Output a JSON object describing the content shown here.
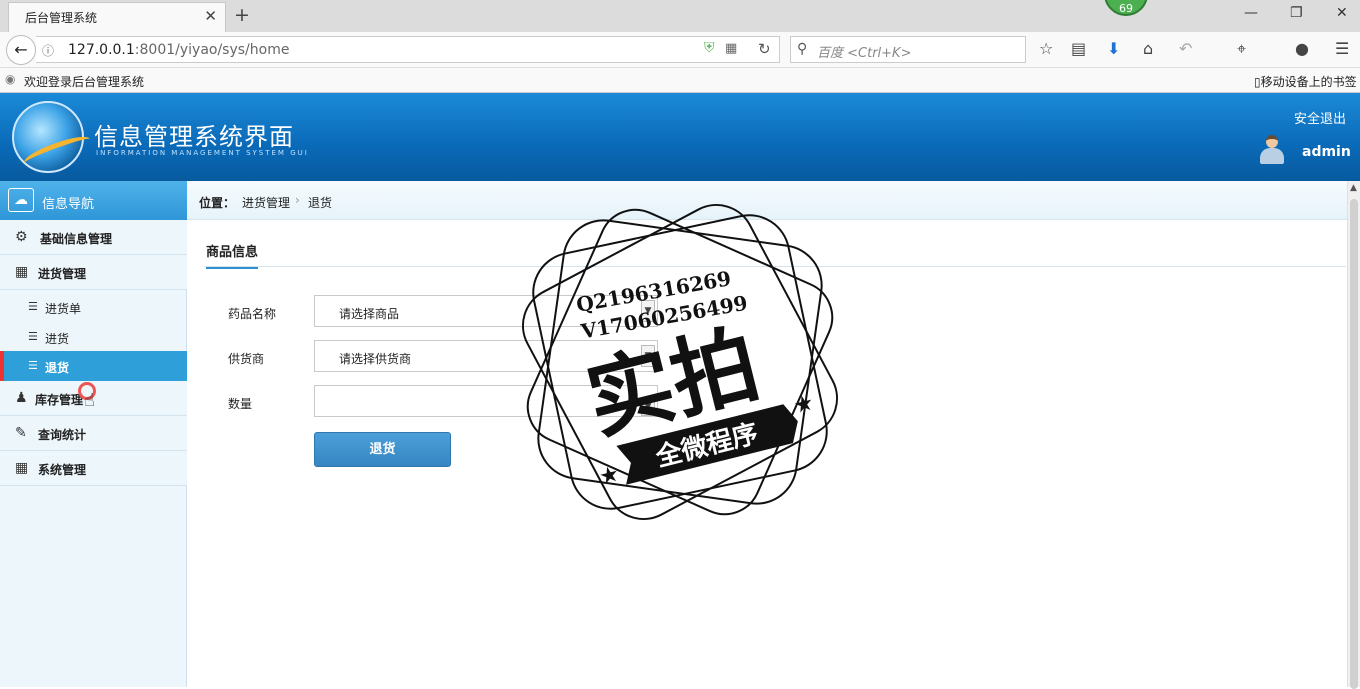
{
  "browser": {
    "tab_title": "后台管理系统",
    "tab_close": "✕",
    "new_tab": "+",
    "ext_badge": "69",
    "url_host": "127.0.0.1",
    "url_rest": ":8001/yiyao/sys/home",
    "search_placeholder": "百度 <Ctrl+K>",
    "bookmark": "欢迎登录后台管理系统",
    "mobile_bookmarks": "移动设备上的书签"
  },
  "header": {
    "title": "信息管理系统界面",
    "subtitle": "INFORMATION MANAGEMENT SYSTEM GUI",
    "logout": "安全退出",
    "user": "admin"
  },
  "sidebar": {
    "title": "信息导航",
    "items": [
      {
        "label": "基础信息管理",
        "icon": "gears-icon"
      },
      {
        "label": "进货管理",
        "icon": "calendar-icon"
      },
      {
        "label": "库存管理",
        "icon": "users-icon"
      },
      {
        "label": "查询统计",
        "icon": "edit-icon"
      },
      {
        "label": "系统管理",
        "icon": "calendar-icon"
      }
    ],
    "subitems": [
      {
        "label": "进货单",
        "icon": "list-icon"
      },
      {
        "label": "进货",
        "icon": "list-icon"
      },
      {
        "label": "退货",
        "icon": "list-icon",
        "active": true
      }
    ]
  },
  "breadcrumb": {
    "label": "位置：",
    "level1": "进货管理",
    "sep": "›",
    "level2": "退货"
  },
  "form": {
    "section": "商品信息",
    "drug_label": "药品名称",
    "drug_value": "请选择商品",
    "supplier_label": "供货商",
    "supplier_value": "请选择供货商",
    "qty_label": "数量",
    "qty_value": "",
    "submit": "退货"
  },
  "watermark": {
    "line1": "Q2196316269",
    "line2": "V17060256499",
    "big": "实拍",
    "banner": "全微程序"
  },
  "colors": {
    "header": "#0a6ab8",
    "active": "#2e9fd8",
    "button": "#3586c2"
  }
}
